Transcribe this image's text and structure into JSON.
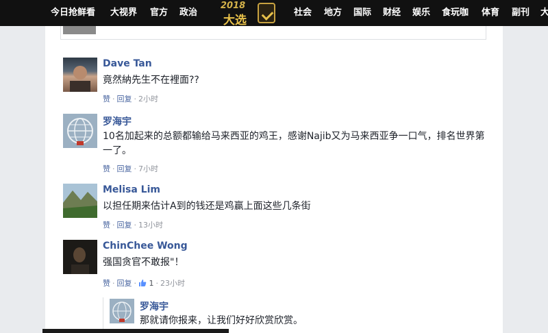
{
  "nav": {
    "left": [
      "今日抢鲜看",
      "大视界",
      "官方",
      "政治"
    ],
    "right": [
      "社会",
      "地方",
      "国际",
      "财经",
      "娱乐",
      "食玩咖",
      "体育",
      "副刊",
      "大"
    ],
    "logo_year": "2018",
    "logo_text": "大选"
  },
  "comments": [
    {
      "author": "Dave Tan",
      "text": "竟然納先生不在裡面??",
      "like": "赞",
      "reply": "回复",
      "time": "2小时"
    },
    {
      "author": "罗海宇",
      "text": "10名加起来的总额都输给马来西亚的鸡王，感谢Najib又为马来西亚争一口气，排名世界第一了。",
      "like": "赞",
      "reply": "回复",
      "time": "7小时"
    },
    {
      "author": "Melisa Lim",
      "text": "以担任期来估计A到的钱还是鸡赢上面这些几条街",
      "like": "赞",
      "reply": "回复",
      "time": "13小时"
    },
    {
      "author": "ChinChee Wong",
      "text": "强国贪官不敢报\"！",
      "like": "赞",
      "reply": "回复",
      "likes_count": "1",
      "time": "23小时"
    }
  ],
  "reply": {
    "author": "罗海宇",
    "text": "那就请你报来，让我们好好欣赏欣赏。"
  },
  "colors": {
    "author": "#385898",
    "nav_bg": "#111111",
    "page_bg": "#e9ebee"
  }
}
